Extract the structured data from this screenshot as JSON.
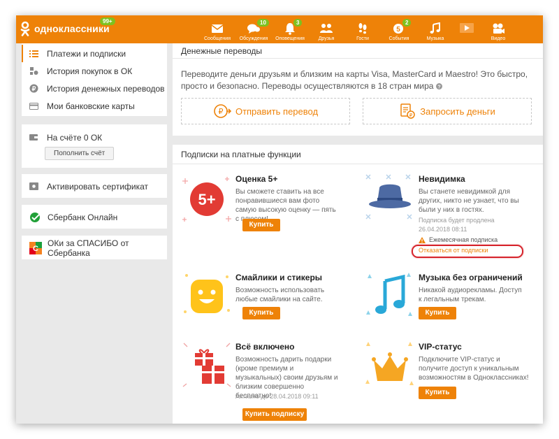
{
  "brand": {
    "name": "одноклассники",
    "badge": "99+"
  },
  "nav": [
    {
      "label": "Сообщения",
      "icon": "envelope-icon",
      "badge": ""
    },
    {
      "label": "Обсуждения",
      "icon": "chat-bubbles-icon",
      "badge": "10"
    },
    {
      "label": "Оповещения",
      "icon": "bell-icon",
      "badge": "3"
    },
    {
      "label": "Друзья",
      "icon": "friends-icon",
      "badge": ""
    },
    {
      "label": "Гости",
      "icon": "footprints-icon",
      "badge": ""
    },
    {
      "label": "События",
      "icon": "events-icon",
      "badge": "2"
    },
    {
      "label": "Музыка",
      "icon": "music-note-icon",
      "badge": ""
    },
    {
      "label": "",
      "icon": "play-icon",
      "badge": ""
    },
    {
      "label": "Видео",
      "icon": "video-camera-icon",
      "badge": ""
    }
  ],
  "sidebar": {
    "menu": [
      {
        "label": "Платежи и подписки",
        "icon": "list-icon"
      },
      {
        "label": "История покупок в ОК",
        "icon": "purchase-history-icon"
      },
      {
        "label": "История денежных переводов",
        "icon": "ruble-coin-icon"
      },
      {
        "label": "Мои банковские карты",
        "icon": "bank-card-icon"
      }
    ],
    "balance": {
      "label": "На счёте 0 ОК",
      "button": "Пополнить счёт"
    },
    "certificate": "Активировать сертификат",
    "sberbank": "Сбербанк Онлайн",
    "spasibo": "ОКи за СПАСИБО от Сбербанка"
  },
  "transfers": {
    "header": "Денежные переводы",
    "text": "Переводите деньги друзьям и близким на карты Visa, MasterCard и Maestro! Это быстро, просто и безопасно. Переводы осуществляются в 18 стран мира",
    "send": "Отправить перевод",
    "request": "Запросить деньги"
  },
  "subscriptions": {
    "header": "Подписки на платные функции",
    "rating": {
      "title": "Оценка 5+",
      "badge": "5+",
      "desc": "Вы сможете ставить на все понравившиеся вам фото самую высокую оценку — пять с плюсом!",
      "button": "Купить"
    },
    "invisible": {
      "title": "Невидимка",
      "desc": "Вы станете невидимкой для других, никто не узнает, что вы были у них в гостях.",
      "renew": "Подписка будет продлена",
      "renew_date": "26.04.2018 08:11",
      "monthly": "Ежемесячная подписка",
      "unsubscribe": "Отказаться от подписки"
    },
    "stickers": {
      "title": "Смайлики и стикеры",
      "desc": "Возможность использовать любые смайлики на сайте.",
      "button": "Купить"
    },
    "music": {
      "title": "Музыка без ограничений",
      "desc": "Никакой аудиорекламы. Доступ к легальным трекам.",
      "button": "Купить"
    },
    "all": {
      "title": "Всё включено",
      "desc": "Возможность дарить подарки (кроме премиум и музыкальных) своим друзьям и близким совершенно бесплатно!",
      "active": "Активно до 28.04.2018 09:11",
      "button": "Купить подписку"
    },
    "vip": {
      "title": "VIP-статус",
      "desc": "Подключите VIP-статус и получите доступ к уникальным возможностям в Одноклассниках!",
      "button": "Купить"
    }
  },
  "colors": {
    "accent": "#ee8208",
    "badge": "#7ec11f",
    "highlight": "#d6232b"
  }
}
